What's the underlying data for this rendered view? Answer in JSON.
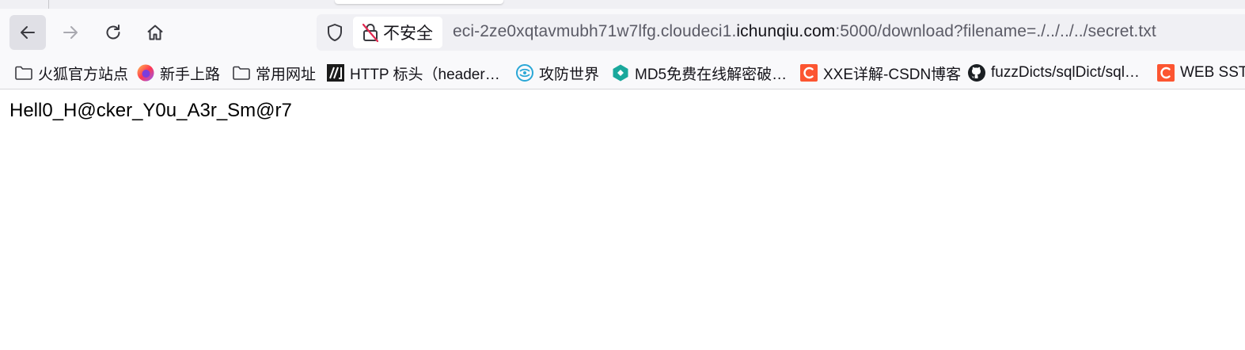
{
  "toolbar": {
    "back_icon": "arrow-left-icon",
    "forward_icon": "arrow-right-icon",
    "reload_icon": "reload-icon",
    "home_icon": "home-icon"
  },
  "urlbar": {
    "security_label": "不安全",
    "url_prefix": "eci-2ze0xqtavmubh71w7lfg.cloudeci1.",
    "url_domain": "ichunqiu.com",
    "url_suffix": ":5000/download?filename=./../../../secret.txt"
  },
  "bookmarks": [
    {
      "label": "火狐官方站点",
      "icon": "folder-icon"
    },
    {
      "label": "新手上路",
      "icon": "firefox-icon"
    },
    {
      "label": "常用网址",
      "icon": "folder-icon"
    },
    {
      "label": "HTTP 标头（header…",
      "icon": "mdn-icon"
    },
    {
      "label": "攻防世界",
      "icon": "adworld-icon"
    },
    {
      "label": "MD5免费在线解密破…",
      "icon": "cmd5-icon"
    },
    {
      "label": "XXE详解-CSDN博客",
      "icon": "csdn-icon"
    },
    {
      "label": "fuzzDicts/sqlDict/sql…",
      "icon": "github-icon"
    },
    {
      "label": "WEB SST",
      "icon": "csdn-icon"
    }
  ],
  "page": {
    "content_text": "Hell0_H@cker_Y0u_A3r_Sm@r7"
  },
  "colors": {
    "toolbar_bg": "#f9f9fb",
    "urlbar_bg": "#f0f0f4",
    "csdn_red": "#fc5531",
    "text": "#15141a"
  }
}
